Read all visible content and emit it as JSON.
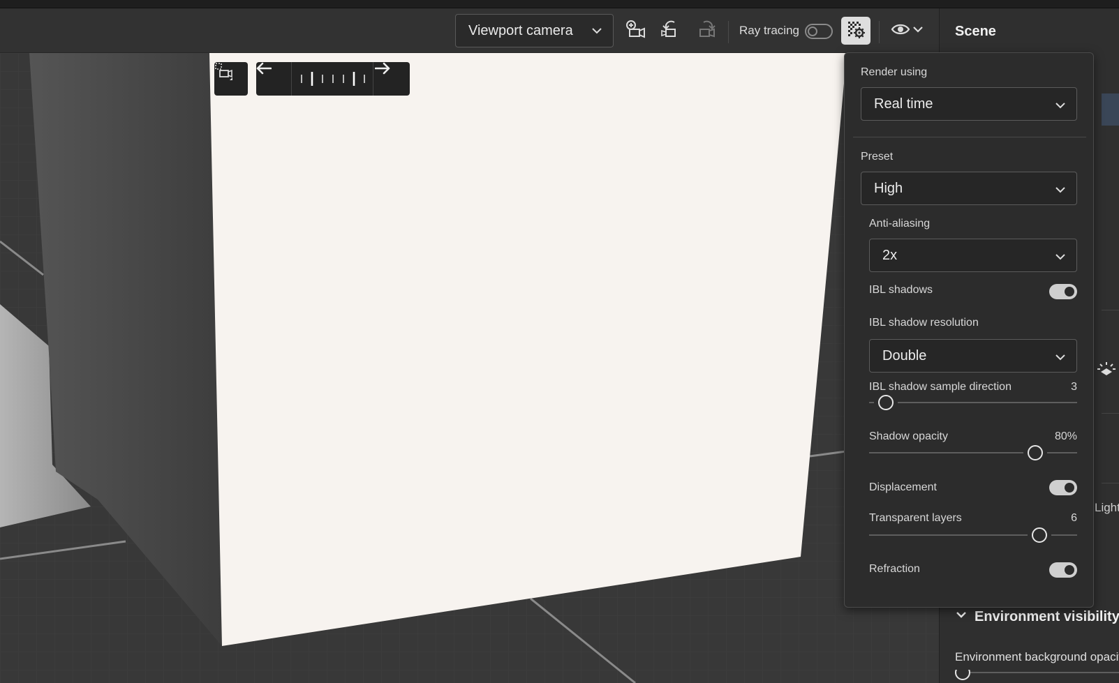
{
  "toolbar": {
    "camera_select_value": "Viewport camera",
    "ray_tracing_label": "Ray tracing",
    "ray_tracing_enabled": false
  },
  "right_panel": {
    "title": "Scene",
    "environment_visibility_label": "Environment visibility",
    "environment_background_opacity_label": "Environment background opacit",
    "lights_fragment": "Lights"
  },
  "render_popover": {
    "render_using_label": "Render using",
    "render_using_value": "Real time",
    "preset_label": "Preset",
    "preset_value": "High",
    "anti_aliasing_label": "Anti-aliasing",
    "anti_aliasing_value": "2x",
    "ibl_shadows_label": "IBL shadows",
    "ibl_shadows_enabled": true,
    "ibl_shadow_resolution_label": "IBL shadow resolution",
    "ibl_shadow_resolution_value": "Double",
    "ibl_shadow_sample_direction_label": "IBL shadow sample direction",
    "ibl_shadow_sample_direction_value": "3",
    "ibl_shadow_sample_direction_fraction": 0.08,
    "shadow_opacity_label": "Shadow opacity",
    "shadow_opacity_value": "80%",
    "shadow_opacity_fraction": 0.8,
    "displacement_label": "Displacement",
    "displacement_enabled": true,
    "transparent_layers_label": "Transparent layers",
    "transparent_layers_value": "6",
    "transparent_layers_fraction": 0.82,
    "refraction_label": "Refraction",
    "refraction_enabled": true
  },
  "icons": {
    "add_camera": "add-camera-icon",
    "undo_camera": "undo-camera-icon",
    "redo_camera": "redo-camera-icon",
    "render_settings": "render-settings-icon",
    "visibility": "eye-icon",
    "fit_camera": "fit-camera-icon",
    "prev": "arrow-left-icon",
    "next": "arrow-right-icon"
  }
}
